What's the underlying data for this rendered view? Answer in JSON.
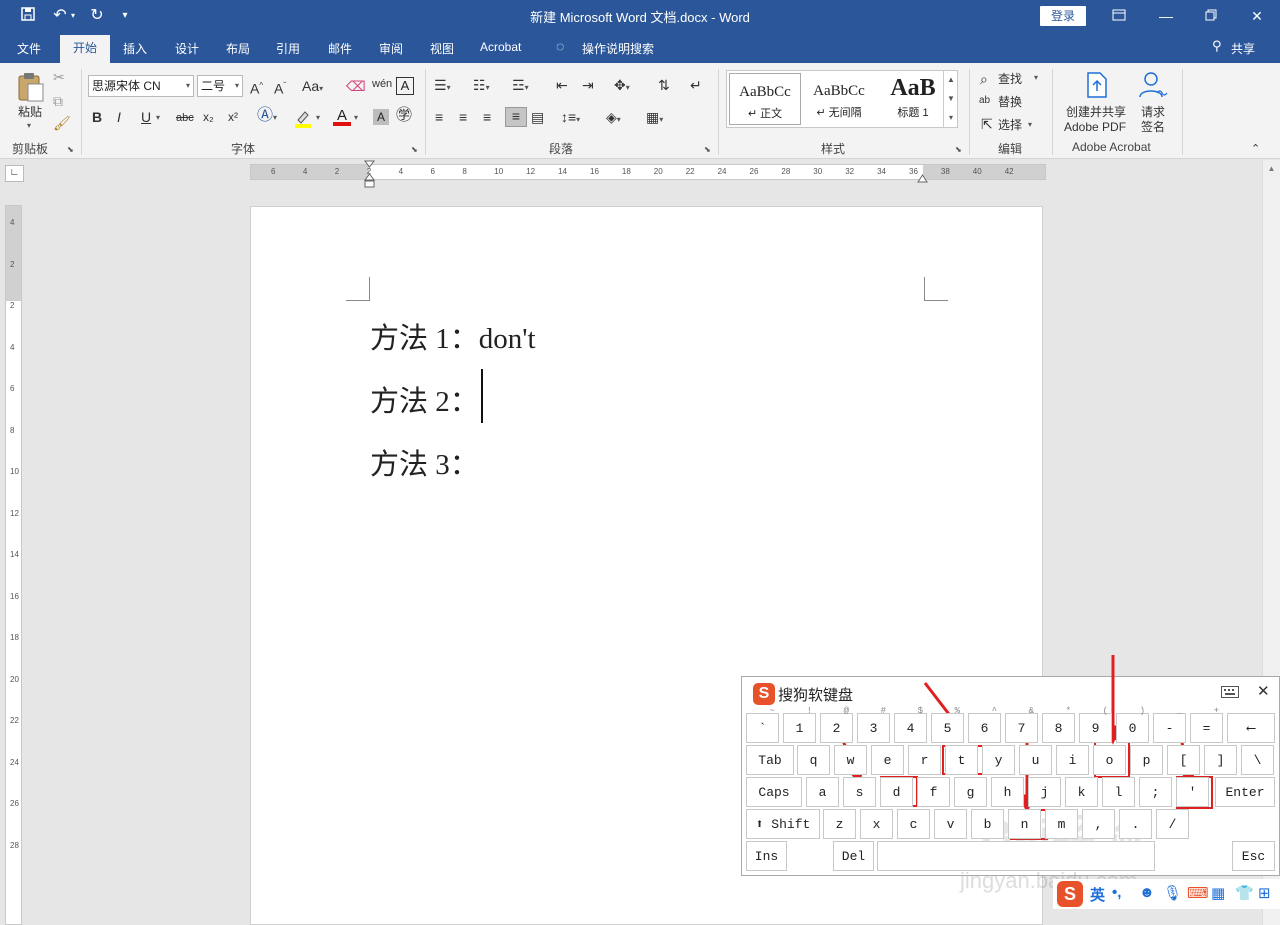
{
  "titlebar": {
    "document_title": "新建 Microsoft Word 文档.docx  -  Word",
    "login_label": "登录",
    "save_icon": "save-icon",
    "undo_icon": "undo-icon",
    "redo_icon": "redo-icon"
  },
  "tabs": [
    {
      "label": "文件"
    },
    {
      "label": "开始"
    },
    {
      "label": "插入"
    },
    {
      "label": "设计"
    },
    {
      "label": "布局"
    },
    {
      "label": "引用"
    },
    {
      "label": "邮件"
    },
    {
      "label": "审阅"
    },
    {
      "label": "视图"
    },
    {
      "label": "Acrobat"
    },
    {
      "label": "操作说明搜索"
    }
  ],
  "share_label": "共享",
  "clipboard": {
    "paste_label": "粘贴",
    "group_label": "剪贴板"
  },
  "font": {
    "font_name": "思源宋体 CN",
    "font_size": "二号",
    "group_label": "字体",
    "clear_format_label": "A",
    "bold": "B",
    "italic": "I",
    "underline": "U",
    "strike": "abc",
    "sub": "x₂",
    "sup": "x²"
  },
  "paragraph": {
    "group_label": "段落"
  },
  "styles": {
    "group_label": "样式",
    "items": [
      {
        "preview": "AaBbCc",
        "name": "↵ 正文"
      },
      {
        "preview": "AaBbCc",
        "name": "↵ 无间隔"
      },
      {
        "preview": "AaB",
        "name": "标题 1"
      }
    ]
  },
  "editing": {
    "group_label": "编辑",
    "find": "查找",
    "replace": "替换",
    "select": "选择"
  },
  "acrobat": {
    "group_label": "Adobe Acrobat",
    "create_share_line1": "创建并共享",
    "create_share_line2": "Adobe PDF",
    "request_sign_line1": "请求",
    "request_sign_line2": "签名"
  },
  "ruler": {
    "h_ticks": [
      "6",
      "4",
      "2",
      "2",
      "4",
      "6",
      "8",
      "10",
      "12",
      "14",
      "16",
      "18",
      "20",
      "22",
      "24",
      "26",
      "28",
      "30",
      "32",
      "34",
      "36",
      "38",
      "40",
      "42"
    ],
    "v_ticks": [
      "4",
      "2",
      "2",
      "4",
      "6",
      "8",
      "10",
      "12",
      "14",
      "16",
      "18",
      "20",
      "22",
      "24",
      "26",
      "28"
    ]
  },
  "document": {
    "lines": [
      "方法 1：don't",
      "方法 2：",
      "方法 3："
    ]
  },
  "soft_keyboard": {
    "title": "搜狗软键盘",
    "row1": [
      {
        "k": "`",
        "s": "~"
      },
      {
        "k": "1",
        "s": "!"
      },
      {
        "k": "2",
        "s": "@"
      },
      {
        "k": "3",
        "s": "#"
      },
      {
        "k": "4",
        "s": "$"
      },
      {
        "k": "5",
        "s": "%"
      },
      {
        "k": "6",
        "s": "^"
      },
      {
        "k": "7",
        "s": "&"
      },
      {
        "k": "8",
        "s": "*"
      },
      {
        "k": "9",
        "s": "("
      },
      {
        "k": "0",
        "s": ")"
      },
      {
        "k": "-",
        "s": "_"
      },
      {
        "k": "=",
        "s": "+"
      }
    ],
    "backspace": "⟵",
    "tab": "Tab",
    "row2": [
      "q",
      "w",
      "e",
      "r",
      "t",
      "y",
      "u",
      "i",
      "o",
      "p",
      "[",
      "]",
      "\\"
    ],
    "caps": "Caps",
    "row3": [
      "a",
      "s",
      "d",
      "f",
      "g",
      "h",
      "j",
      "k",
      "l",
      ";",
      "'"
    ],
    "enter": "Enter",
    "shift": "⬆ Shift",
    "row4": [
      "z",
      "x",
      "c",
      "v",
      "b",
      "n",
      "m",
      ",",
      ".",
      "/"
    ],
    "ins": "Ins",
    "del": "Del",
    "esc": "Esc"
  },
  "ime_bar": {
    "lang": "英",
    "punct": "•,"
  },
  "watermark": {
    "line1": "Bai经验",
    "line2": "jingyan.baidu.com"
  },
  "colors": {
    "accent": "#2b579a",
    "highlight_box": "#e02020",
    "sogou_brand": "#e8522b"
  }
}
